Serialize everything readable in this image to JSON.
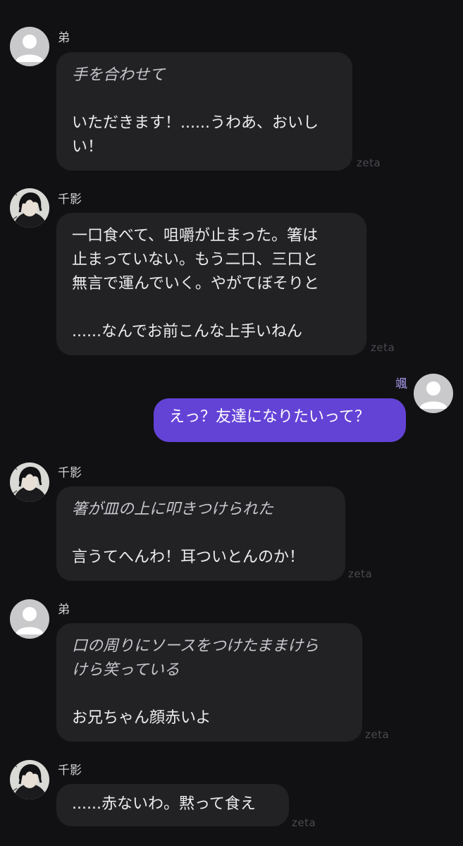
{
  "colors": {
    "background": "#111113",
    "bubble": "#222225",
    "user_bubble": "#6343d6",
    "user_name": "#a99cf0",
    "watermark": "#4a4a50"
  },
  "watermark": "zeta",
  "messages": [
    {
      "sender": "弟",
      "avatar": "default-avatar-icon",
      "action_lines": [
        "手を合わせて"
      ],
      "speech_lines": [
        "いただきます！......うわあ、おいし",
        "い！"
      ]
    },
    {
      "sender": "千影",
      "avatar": "character-portrait",
      "action_lines": [],
      "speech_lines": [
        "一口食べて、咀嚼が止まった。箸は",
        "止まっていない。もう二口、三口と",
        "無言で運んでいく。やがてぼそりと",
        "",
        "......なんでお前こんな上手いねん"
      ]
    },
    {
      "sender": "颯",
      "avatar": "default-avatar-icon",
      "action_lines": [],
      "speech_lines": [
        "えっ？友達になりたいって？"
      ]
    },
    {
      "sender": "千影",
      "avatar": "character-portrait",
      "action_lines": [
        "箸が皿の上に叩きつけられた"
      ],
      "speech_lines": [
        "言うてへんわ！耳ついとんのか！"
      ]
    },
    {
      "sender": "弟",
      "avatar": "default-avatar-icon",
      "action_lines": [
        "口の周りにソースをつけたままけら",
        "けら笑っている"
      ],
      "speech_lines": [
        "お兄ちゃん顔赤いよ"
      ]
    },
    {
      "sender": "千影",
      "avatar": "character-portrait",
      "action_lines": [],
      "speech_lines": [
        "......赤ないわ。黙って食え"
      ]
    }
  ]
}
